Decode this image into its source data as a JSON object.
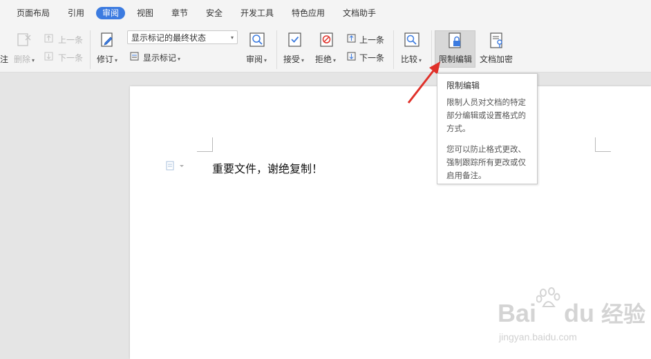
{
  "menu": {
    "items": [
      "页面布局",
      "引用",
      "审阅",
      "视图",
      "章节",
      "安全",
      "开发工具",
      "特色应用",
      "文档助手"
    ],
    "active": "审阅"
  },
  "ribbon": {
    "comment_partial": "注",
    "delete": "删除",
    "prev_comment": "上一条",
    "next_comment": "下一条",
    "revise": "修订",
    "markup_state": "显示标记的最终状态",
    "show_markup": "显示标记",
    "review": "审阅",
    "accept": "接受",
    "reject": "拒绝",
    "prev_change": "上一条",
    "next_change": "下一条",
    "compare": "比较",
    "restrict_editing": "限制编辑",
    "encrypt_doc": "文档加密"
  },
  "tooltip": {
    "title": "限制编辑",
    "line1": "限制人员对文档的特定",
    "line2": "部分编辑或设置格式的",
    "line3": "方式。",
    "line4": "您可以防止格式更改、",
    "line5": "强制跟踪所有更改或仅",
    "line6": "启用备注。"
  },
  "document": {
    "text": "重要文件，谢绝复制！"
  },
  "watermark": {
    "brand": "Bai",
    "brand2": "du",
    "cn": "经验",
    "url": "jingyan.baidu.com"
  },
  "colors": {
    "accent": "#3c7be0",
    "arrow": "#e0312a"
  }
}
